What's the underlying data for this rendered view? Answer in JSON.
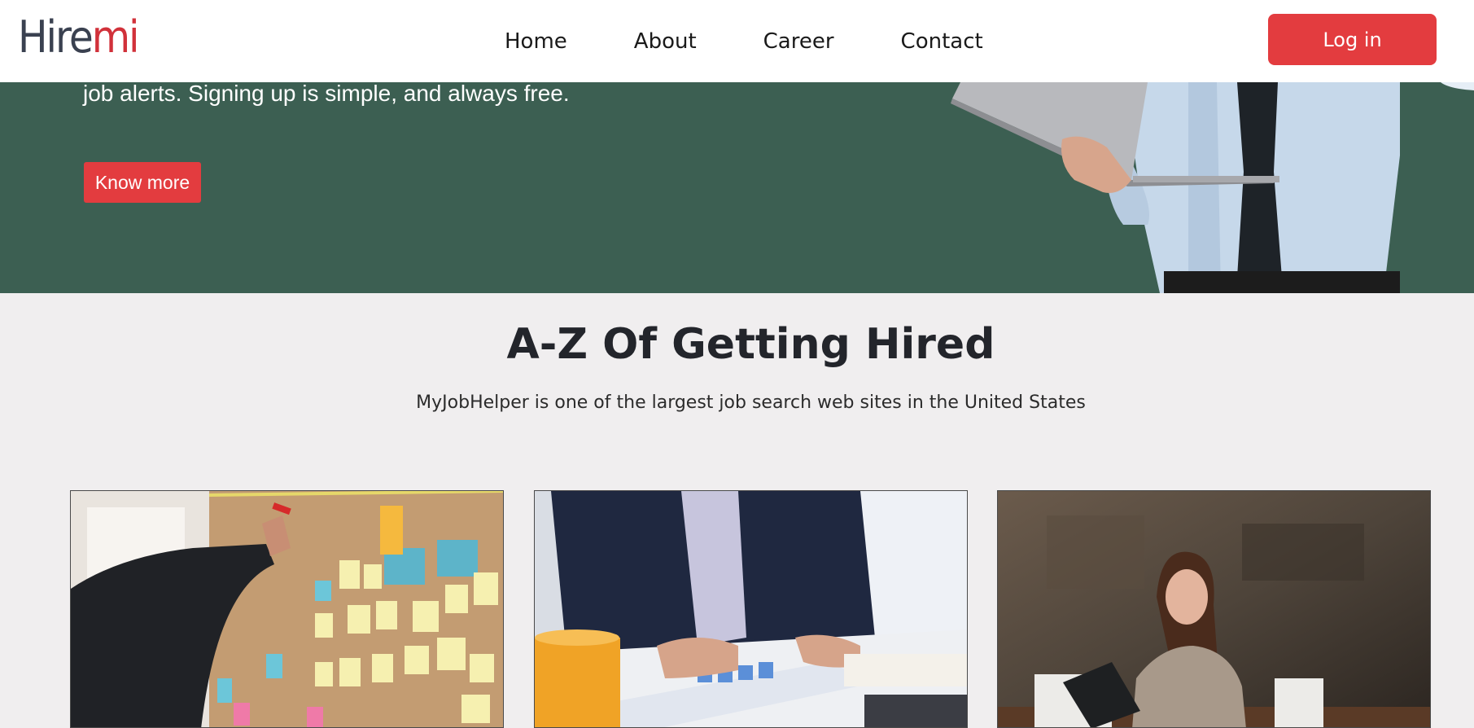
{
  "header": {
    "logo": {
      "part1": "Hire",
      "part2": "mi"
    },
    "nav": [
      "Home",
      "About",
      "Career",
      "Contact"
    ],
    "login_label": "Log in"
  },
  "hero": {
    "text": "job alerts. Signing up is simple, and always free.",
    "button_label": "Know more",
    "background_color": "#3c5f52"
  },
  "section": {
    "title": "A-Z Of Getting Hired",
    "subtitle": "MyJobHelper is one of the largest job search web sites in the United States"
  },
  "colors": {
    "accent": "#e33c3f",
    "page_bg": "#f0eeef"
  }
}
